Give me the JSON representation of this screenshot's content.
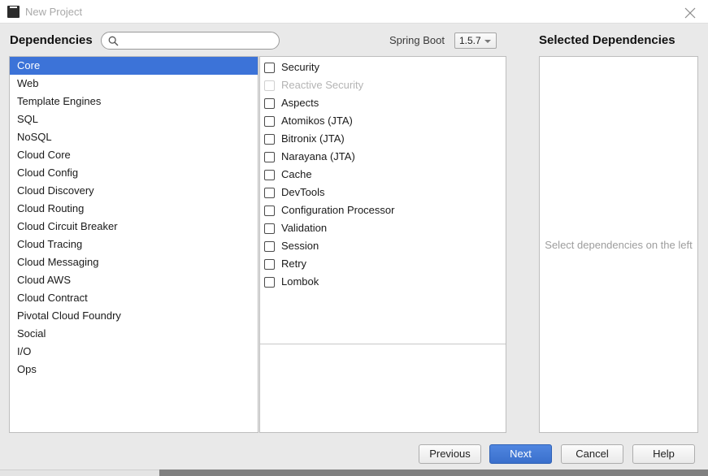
{
  "window": {
    "title": "New Project",
    "app_icon": "intellij-idea-icon",
    "close_icon": "close-icon"
  },
  "header": {
    "dependencies_label": "Dependencies",
    "search": {
      "icon": "search-icon",
      "value": "",
      "placeholder": ""
    },
    "spring_boot_label": "Spring Boot",
    "spring_boot_version": "1.5.7",
    "selected_dependencies_label": "Selected Dependencies"
  },
  "categories": {
    "selected_index": 0,
    "items": [
      "Core",
      "Web",
      "Template Engines",
      "SQL",
      "NoSQL",
      "Cloud Core",
      "Cloud Config",
      "Cloud Discovery",
      "Cloud Routing",
      "Cloud Circuit Breaker",
      "Cloud Tracing",
      "Cloud Messaging",
      "Cloud AWS",
      "Cloud Contract",
      "Pivotal Cloud Foundry",
      "Social",
      "I/O",
      "Ops"
    ]
  },
  "dependencies": {
    "items": [
      {
        "label": "Security",
        "checked": false,
        "disabled": false
      },
      {
        "label": "Reactive Security",
        "checked": false,
        "disabled": true
      },
      {
        "label": "Aspects",
        "checked": false,
        "disabled": false
      },
      {
        "label": "Atomikos (JTA)",
        "checked": false,
        "disabled": false
      },
      {
        "label": "Bitronix (JTA)",
        "checked": false,
        "disabled": false
      },
      {
        "label": "Narayana (JTA)",
        "checked": false,
        "disabled": false
      },
      {
        "label": "Cache",
        "checked": false,
        "disabled": false
      },
      {
        "label": "DevTools",
        "checked": false,
        "disabled": false
      },
      {
        "label": "Configuration Processor",
        "checked": false,
        "disabled": false
      },
      {
        "label": "Validation",
        "checked": false,
        "disabled": false
      },
      {
        "label": "Session",
        "checked": false,
        "disabled": false
      },
      {
        "label": "Retry",
        "checked": false,
        "disabled": false
      },
      {
        "label": "Lombok",
        "checked": false,
        "disabled": false
      }
    ]
  },
  "selected_panel": {
    "placeholder": "Select dependencies on the left"
  },
  "buttons": {
    "previous": "Previous",
    "next": "Next",
    "cancel": "Cancel",
    "help": "Help"
  },
  "colors": {
    "selection_blue": "#3c73d8",
    "primary_button_blue": "#3a6fcc",
    "dialog_background": "#e9e9e9",
    "panel_background": "#ffffff",
    "disabled_text": "#b4b4b4"
  }
}
